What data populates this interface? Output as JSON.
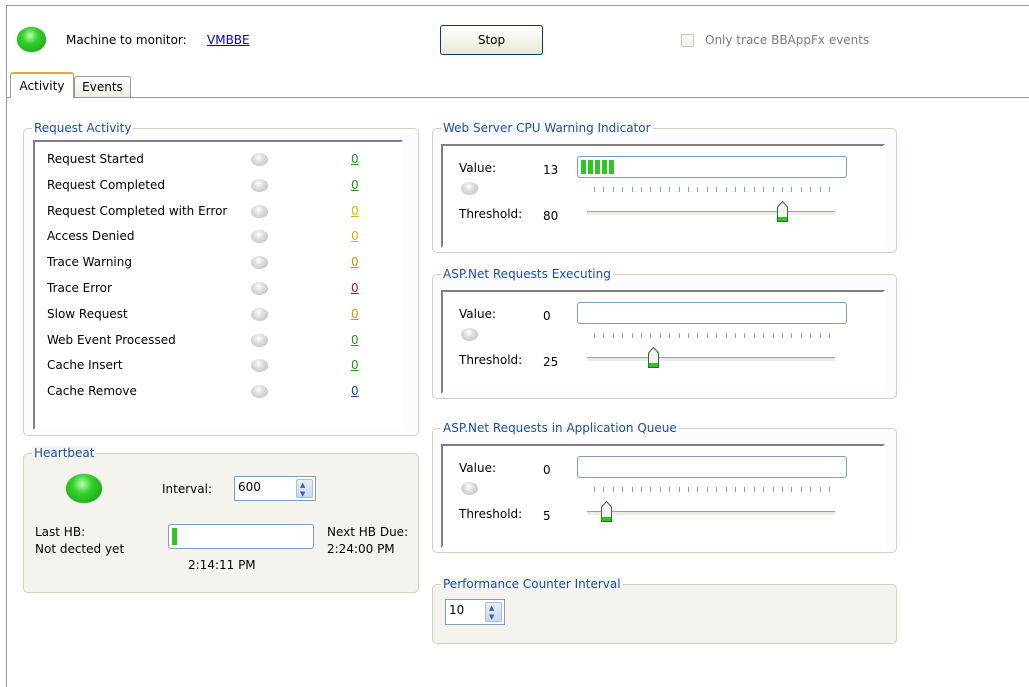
{
  "header": {
    "machine_label": "Machine to monitor:",
    "machine_name": "VMBBE",
    "stop_button": "Stop",
    "trace_only_label": "Only trace BBAppFx events",
    "trace_only_checked": false,
    "status_color": "#22c21a"
  },
  "tabs": [
    {
      "label": "Activity",
      "active": true
    },
    {
      "label": "Events",
      "active": false
    }
  ],
  "request_activity": {
    "title": "Request Activity",
    "rows": [
      {
        "label": "Request Started",
        "count": "0",
        "count_color": "#2a8f1e"
      },
      {
        "label": "Request Completed",
        "count": "0",
        "count_color": "#2a8f1e"
      },
      {
        "label": "Request Completed with Error",
        "count": "0",
        "count_color": "#d3b800"
      },
      {
        "label": "Access Denied",
        "count": "0",
        "count_color": "#d3b800"
      },
      {
        "label": "Trace Warning",
        "count": "0",
        "count_color": "#c79a00"
      },
      {
        "label": "Trace Error",
        "count": "0",
        "count_color": "#b01818"
      },
      {
        "label": "Slow Request",
        "count": "0",
        "count_color": "#c79a00"
      },
      {
        "label": "Web Event Processed",
        "count": "0",
        "count_color": "#2a8f1e"
      },
      {
        "label": "Cache Insert",
        "count": "0",
        "count_color": "#2a8f1e"
      },
      {
        "label": "Cache Remove",
        "count": "0",
        "count_color": "#1f3fa8"
      }
    ]
  },
  "heartbeat": {
    "title": "Heartbeat",
    "interval_label": "Interval:",
    "interval_value": "600",
    "last_hb_label": "Last HB:",
    "last_hb_value": "Not dected yet",
    "progress": 0.02,
    "progress_time": "2:14:11 PM",
    "next_hb_label": "Next HB Due:",
    "next_hb_value": "2:24:00 PM"
  },
  "cpu_indicator": {
    "title": "Web Server CPU Warning Indicator",
    "value_label": "Value:",
    "value": "13",
    "value_fraction": 0.13,
    "threshold_label": "Threshold:",
    "threshold": "80",
    "threshold_fraction": 0.8
  },
  "asp_executing": {
    "title": "ASP.Net Requests Executing",
    "value_label": "Value:",
    "value": "0",
    "value_fraction": 0,
    "threshold_label": "Threshold:",
    "threshold": "25",
    "threshold_fraction": 0.25
  },
  "asp_queue": {
    "title": "ASP.Net Requests in Application Queue",
    "value_label": "Value:",
    "value": "0",
    "value_fraction": 0,
    "threshold_label": "Threshold:",
    "threshold": "5",
    "threshold_fraction": 0.05
  },
  "perf_interval": {
    "title": "Performance Counter Interval",
    "value": "10"
  }
}
